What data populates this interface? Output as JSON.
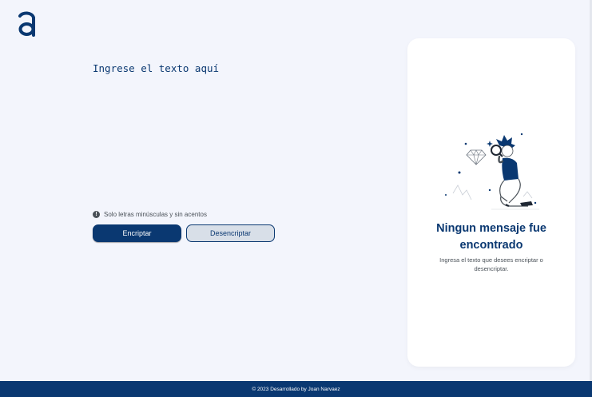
{
  "brand": {
    "logo_icon": "alura-a-logo-icon",
    "color": "#0a3871"
  },
  "editor": {
    "placeholder": "Ingrese el texto aquí"
  },
  "hint": {
    "icon": "exclamation-circle-icon",
    "text": "Solo letras minúsculas y sin acentos"
  },
  "buttons": {
    "encrypt_label": "Encriptar",
    "decrypt_label": "Desencriptar"
  },
  "output_panel": {
    "illustration": "person-with-magnifying-glass-icon",
    "title": "Ningun mensaje fue encontrado",
    "text": "Ingresa el texto que desees encriptar o desencriptar."
  },
  "footer": {
    "text": "© 2023 Desarrollado by Joan Narvaez"
  },
  "colors": {
    "background": "#f3f5fc",
    "primary": "#0a3871",
    "secondary": "#d8dfe8"
  }
}
